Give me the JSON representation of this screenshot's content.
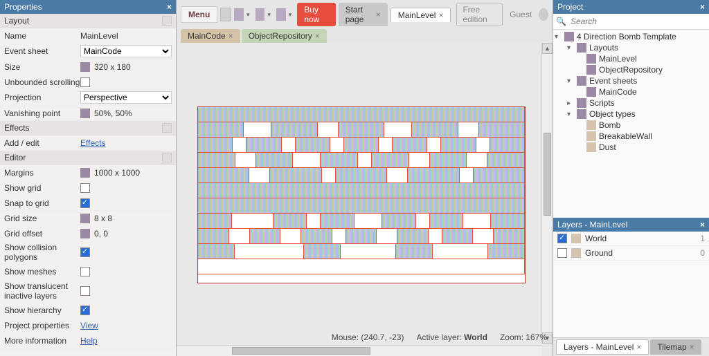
{
  "panels": {
    "properties": "Properties",
    "project": "Project",
    "layers": "Layers - MainLevel"
  },
  "sections": {
    "layout": "Layout",
    "effects": "Effects",
    "editor": "Editor"
  },
  "props": {
    "name_lbl": "Name",
    "name_val": "MainLevel",
    "event_lbl": "Event sheet",
    "event_val": "MainCode",
    "size_lbl": "Size",
    "size_val": "320 x 180",
    "unbounded_lbl": "Unbounded scrolling",
    "proj_lbl": "Projection",
    "proj_val": "Perspective",
    "vanish_lbl": "Vanishing point",
    "vanish_val": "50%, 50%",
    "addedit_lbl": "Add / edit",
    "addedit_link": "Effects",
    "margins_lbl": "Margins",
    "margins_val": "1000 x 1000",
    "showgrid_lbl": "Show grid",
    "snap_lbl": "Snap to grid",
    "gridsize_lbl": "Grid size",
    "gridsize_val": "8 x 8",
    "gridoffset_lbl": "Grid offset",
    "gridoffset_val": "0, 0",
    "collision_lbl": "Show collision polygons",
    "meshes_lbl": "Show meshes",
    "translucent_lbl": "Show translucent inactive layers",
    "hierarchy_lbl": "Show hierarchy",
    "projprops_lbl": "Project properties",
    "projprops_link": "View",
    "moreinfo_lbl": "More information",
    "moreinfo_link": "Help"
  },
  "topbar": {
    "menu": "Menu",
    "buy": "Buy now",
    "start": "Start page",
    "mainlevel": "MainLevel",
    "free": "Free edition",
    "guest": "Guest"
  },
  "subtabs": {
    "maincode": "MainCode",
    "objrepo": "ObjectRepository"
  },
  "status": {
    "mouse_lbl": "Mouse: ",
    "mouse_val": "(240.7, -23)",
    "layer_lbl": "Active layer: ",
    "layer_val": "World",
    "zoom_lbl": "Zoom: ",
    "zoom_val": "167%"
  },
  "search_placeholder": "Search",
  "tree": {
    "root": "4 Direction Bomb Template",
    "layouts": "Layouts",
    "mainlevel": "MainLevel",
    "objrepo": "ObjectRepository",
    "eventsheets": "Event sheets",
    "maincode": "MainCode",
    "scripts": "Scripts",
    "objtypes": "Object types",
    "bomb": "Bomb",
    "breakable": "BreakableWall",
    "dust": "Dust"
  },
  "layers": {
    "world": "World",
    "world_n": "1",
    "ground": "Ground",
    "ground_n": "0"
  },
  "bottom_tabs": {
    "layers": "Layers - MainLevel",
    "tilemap": "Tilemap"
  }
}
